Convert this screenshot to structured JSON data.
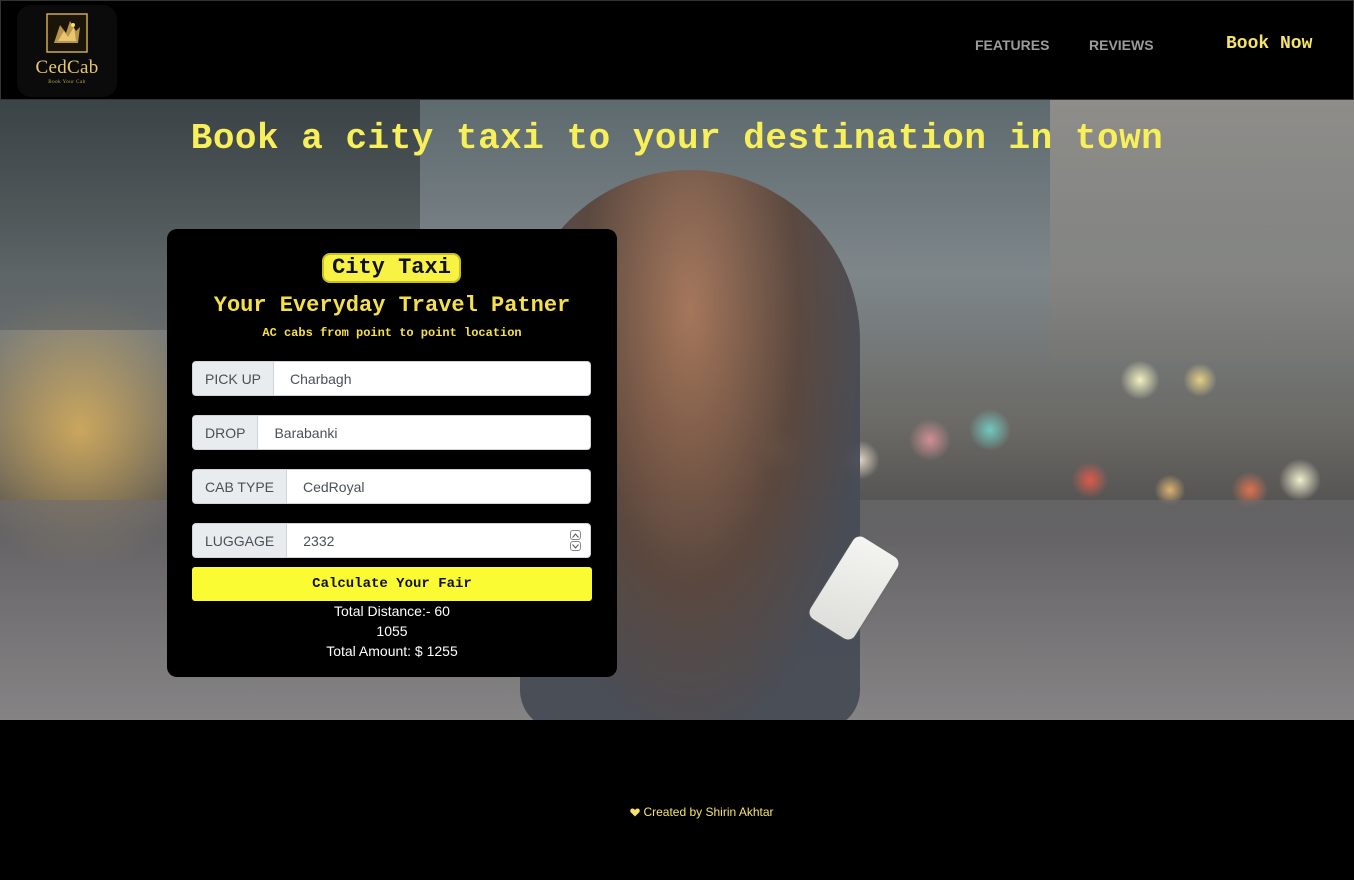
{
  "brand": {
    "name": "CedCab",
    "tagline": "Book Your Cab",
    "logo_color": "#e8c770"
  },
  "nav": {
    "features": "FEATURES",
    "reviews": "REVIEWS",
    "book_now": "Book Now"
  },
  "hero": {
    "title": "Book a city taxi to your destination in town"
  },
  "card": {
    "badge": "City Taxi",
    "heading": "Your Everyday Travel Patner",
    "subheading": "AC cabs from point to point location",
    "fields": {
      "pickup": {
        "label": "PICK UP",
        "value": "Charbagh"
      },
      "drop": {
        "label": "DROP",
        "value": "Barabanki"
      },
      "cab_type": {
        "label": "CAB TYPE",
        "value": "CedRoyal"
      },
      "luggage": {
        "label": "LUGGAGE",
        "value": "2332"
      }
    },
    "button": "Calculate Your Fair",
    "results": {
      "distance": "Total Distance:- 60",
      "intermediate": "1055",
      "amount": "Total Amount: $ 1255"
    }
  },
  "footer": {
    "credit": "Created by Shirin Akhtar",
    "icon": "heart-icon"
  },
  "colors": {
    "accent_yellow": "#f7f243",
    "title_yellow": "#f7f05a",
    "background": "#000000"
  }
}
